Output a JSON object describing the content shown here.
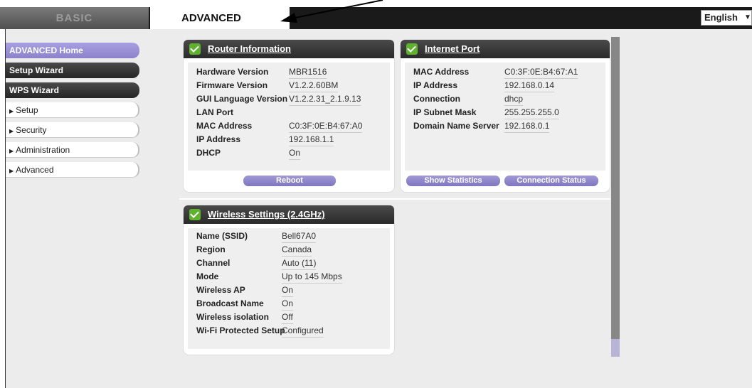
{
  "tabs": {
    "basic": "BASIC",
    "advanced": "ADVANCED"
  },
  "language": {
    "selected": "English"
  },
  "sidebar": {
    "items": [
      {
        "label": "ADVANCED Home"
      },
      {
        "label": "Setup Wizard"
      },
      {
        "label": "WPS Wizard"
      },
      {
        "label": "Setup"
      },
      {
        "label": "Security"
      },
      {
        "label": "Administration"
      },
      {
        "label": "Advanced"
      }
    ]
  },
  "router_info": {
    "title": "Router Information",
    "rows": [
      {
        "label": "Hardware Version",
        "value": "MBR1516"
      },
      {
        "label": "Firmware Version",
        "value": "V1.2.2.60BM"
      },
      {
        "label": "GUI Language Version",
        "value": "V1.2.2.31_2.1.9.13"
      },
      {
        "label": "LAN Port",
        "value": ""
      },
      {
        "label": "MAC Address",
        "value": "C0:3F:0E:B4:67:A0"
      },
      {
        "label": "IP Address",
        "value": "192.168.1.1"
      },
      {
        "label": "DHCP",
        "value": "On"
      }
    ],
    "reboot_label": "Reboot"
  },
  "internet_port": {
    "title": "Internet Port",
    "rows": [
      {
        "label": "MAC Address",
        "value": "C0:3F:0E:B4:67:A1"
      },
      {
        "label": "IP Address",
        "value": "192.168.0.14"
      },
      {
        "label": "Connection",
        "value": "dhcp"
      },
      {
        "label": "IP Subnet Mask",
        "value": "255.255.255.0"
      },
      {
        "label": "Domain Name Server",
        "value": "192.168.0.1"
      }
    ],
    "show_statistics_label": "Show Statistics",
    "connection_status_label": "Connection Status"
  },
  "wireless": {
    "title": "Wireless Settings (2.4GHz)",
    "rows": [
      {
        "label": "Name (SSID)",
        "value": "Bell67A0"
      },
      {
        "label": "Region",
        "value": "Canada"
      },
      {
        "label": "Channel",
        "value": "Auto (11)"
      },
      {
        "label": "Mode",
        "value": "Up to 145 Mbps"
      },
      {
        "label": "Wireless AP",
        "value": "On"
      },
      {
        "label": "Broadcast Name",
        "value": "On"
      },
      {
        "label": "Wireless isolation",
        "value": "Off"
      },
      {
        "label": "Wi-Fi Protected Setup",
        "value": "Configured"
      }
    ]
  },
  "icons": {
    "card_header": "checkmark-icon",
    "language_dropdown": "chevron-down-icon"
  },
  "colors": {
    "accent": "#8b82cc",
    "check": "#5fb22d",
    "header_dark": "#2a2a2a"
  }
}
